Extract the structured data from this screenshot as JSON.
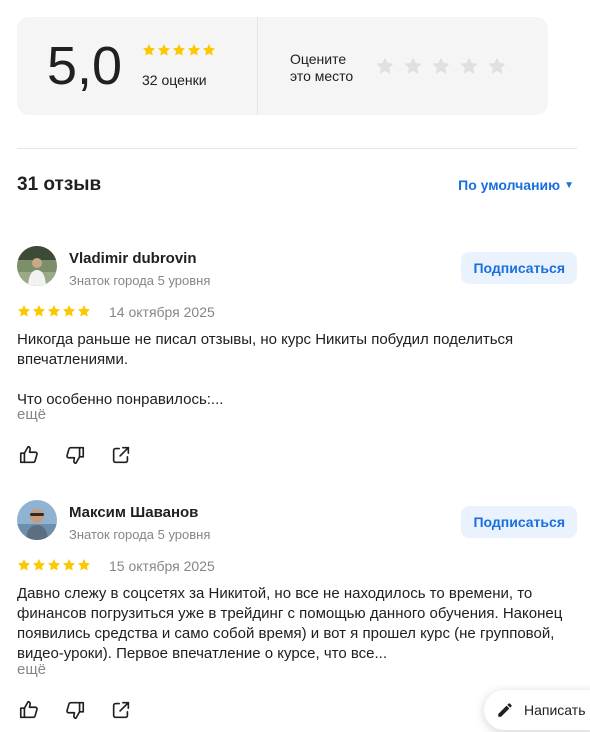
{
  "summary": {
    "score": "5,0",
    "stars": 5,
    "ratings_count": "32 оценки",
    "rate_label": "Оцените\nэто место"
  },
  "reviews_header": {
    "count": "31 отзыв",
    "sort": "По умолчанию"
  },
  "reviews": [
    {
      "author": "Vladimir dubrovin",
      "level": "Знаток города 5 уровня",
      "subscribe": "Подписаться",
      "stars": 5,
      "date": "14 октября 2025",
      "text": "Никогда раньше не писал отзывы, но курс Никиты побудил поделиться впечатлениями.\n\nЧто особенно понравилось:...",
      "more": "ещё"
    },
    {
      "author": "Максим Шаванов",
      "level": "Знаток города 5 уровня",
      "subscribe": "Подписаться",
      "stars": 5,
      "date": "15 октября 2025",
      "text": "Давно слежу в соцсетях за Никитой, но все не находилось то времени, то финансов погрузиться уже в трейдинг с помощью данного обучения. Наконец появились средства и само собой время) и вот я прошел курс (не групповой, видео-уроки). Первое впечатление о курсе, что все...",
      "more": "ещё"
    }
  ],
  "write_button": "Написать",
  "colors": {
    "star_filled": "#fcc800",
    "star_empty": "#e0e0e0",
    "link_blue": "#1a6fe0",
    "subscribe_bg": "#eaf2fd"
  },
  "icons": [
    "star-icon",
    "thumb-up-icon",
    "thumb-down-icon",
    "share-icon",
    "pencil-icon"
  ]
}
